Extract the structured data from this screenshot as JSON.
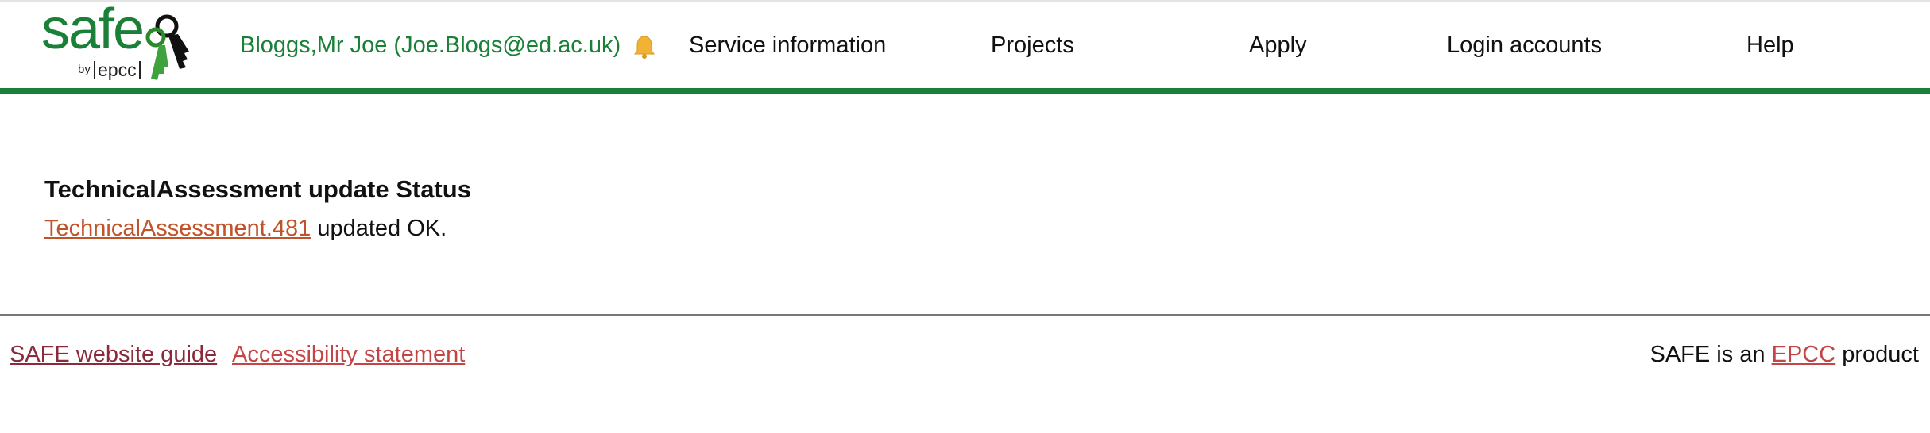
{
  "logo": {
    "word": "safe",
    "by": "by",
    "epcc": "epcc"
  },
  "header": {
    "user": "Bloggs,Mr Joe (Joe.Blogs@ed.ac.uk)",
    "bell_icon": "bell-icon",
    "nav": [
      {
        "label": "Service information"
      },
      {
        "label": "Projects"
      },
      {
        "label": "Apply"
      },
      {
        "label": "Login accounts"
      },
      {
        "label": "Help"
      }
    ]
  },
  "main": {
    "title": "TechnicalAssessment update Status",
    "link": "TechnicalAssessment.481",
    "message": " updated OK."
  },
  "footer": {
    "guide": "SAFE website guide",
    "accessibility": "Accessibility statement",
    "prefix": "SAFE is an ",
    "epcc": "EPCC",
    "suffix": " product"
  },
  "colors": {
    "brand_green": "#1a8038",
    "link_orange": "#c0532a",
    "footer_link_dark": "#8a2a3a",
    "footer_link_red": "#c44545",
    "bell_yellow": "#f2b233"
  }
}
